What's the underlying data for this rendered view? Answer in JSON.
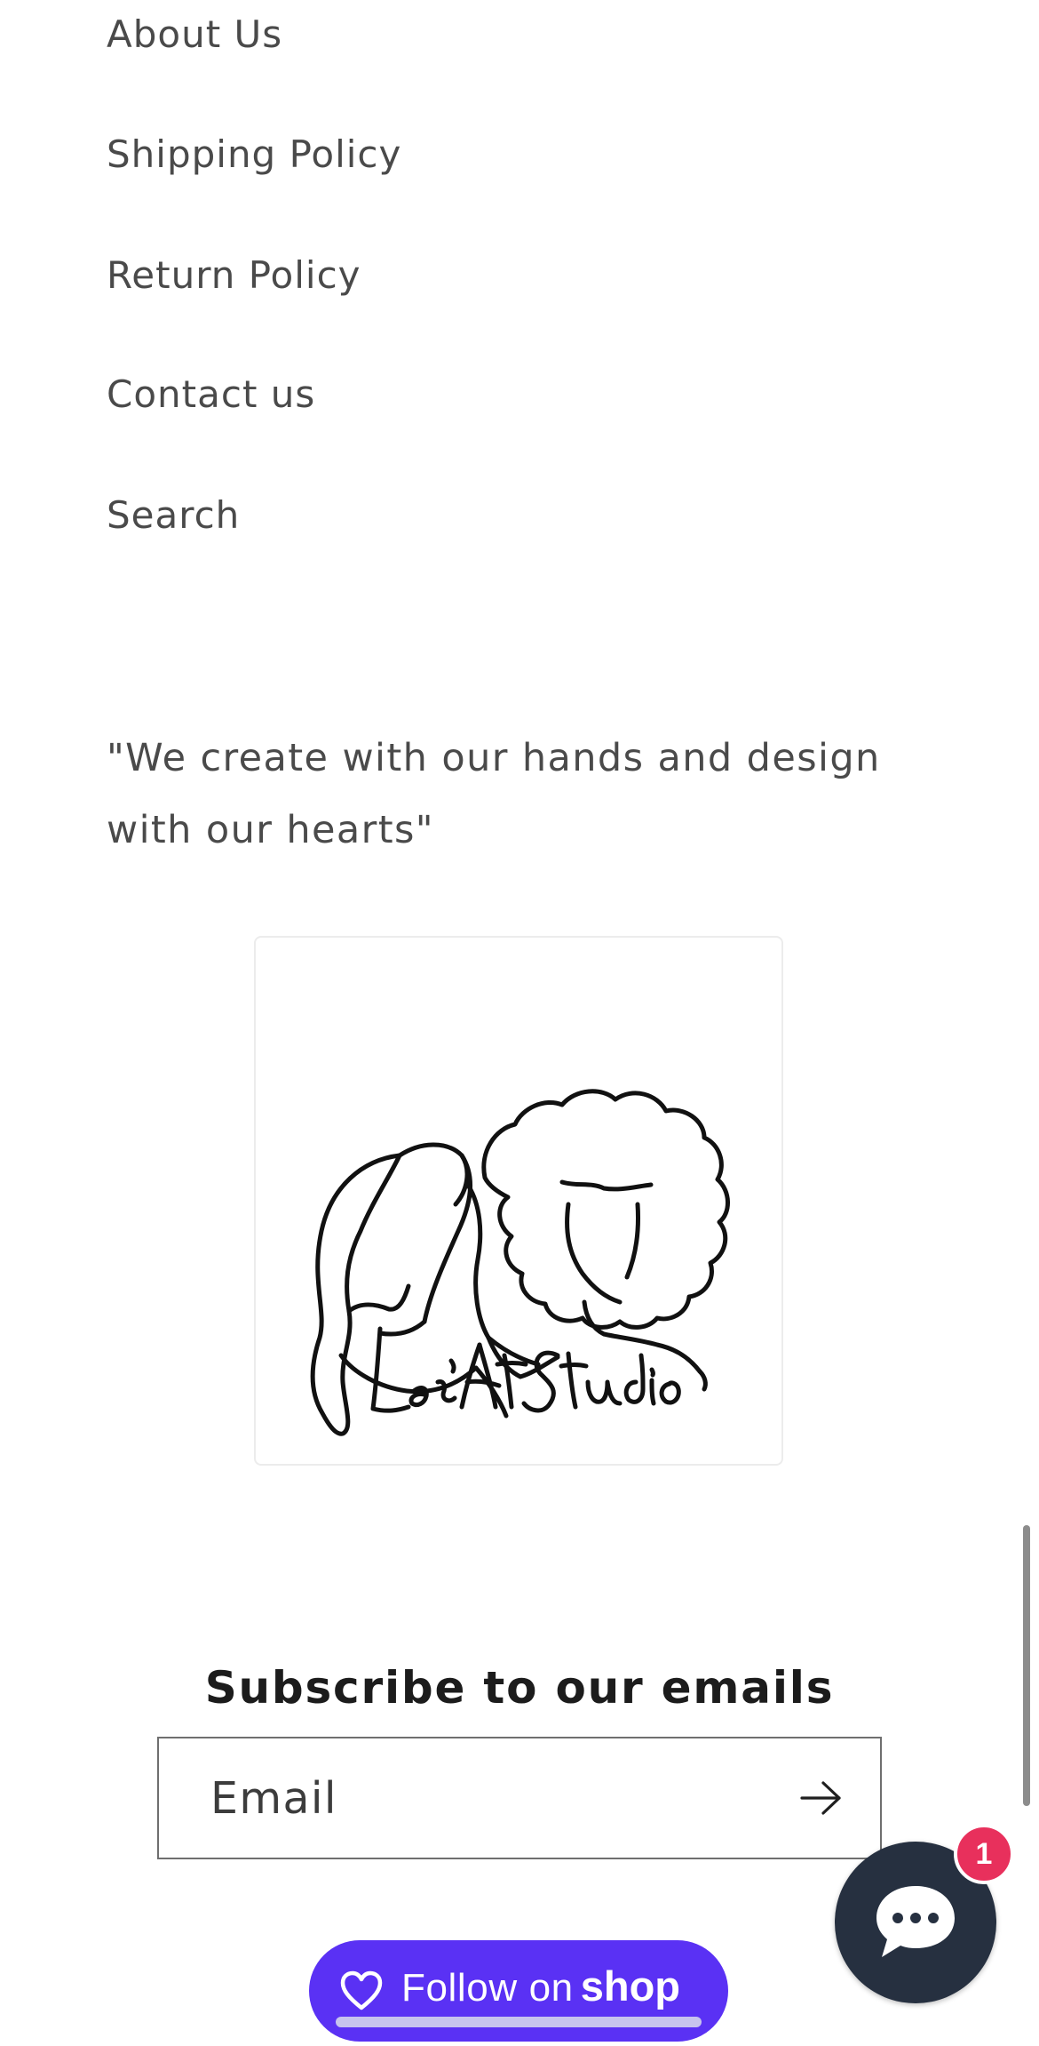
{
  "footer_menu": {
    "items": [
      {
        "label": "About Us"
      },
      {
        "label": "Shipping Policy"
      },
      {
        "label": "Return Policy"
      },
      {
        "label": "Contact us"
      },
      {
        "label": "Search"
      }
    ]
  },
  "brand": {
    "quote": "\"We create with our hands and design with our hearts\"",
    "logo_text": "Lee's Art Studio"
  },
  "newsletter": {
    "heading": "Subscribe to our emails",
    "email_placeholder": "Email",
    "submit_icon": "arrow-right-icon"
  },
  "shop_follow": {
    "label": "Follow on",
    "brand_word": "shop",
    "icon": "heart-icon",
    "color": "#5a31f4"
  },
  "chat": {
    "icon": "chat-bubble-icon",
    "unread_count": "1",
    "badge_color": "#e8305c",
    "button_color": "#263040"
  }
}
